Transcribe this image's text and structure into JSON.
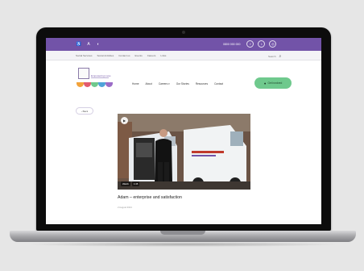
{
  "colors": {
    "topbar": "#7253a8",
    "cta": "#6fc98d",
    "logo_dots": [
      "#f2a23a",
      "#e25b6e",
      "#6fc98d",
      "#4fa3d9",
      "#9b6cc7"
    ]
  },
  "topbar": {
    "left_icons": [
      "accessibility-icon",
      "text-size-icon",
      "contrast-icon"
    ],
    "phone": "0800 000 000",
    "social_icons": [
      "facebook-icon",
      "twitter-icon",
      "instagram-icon"
    ]
  },
  "subnav": {
    "items": [
      "Social Services",
      "Social Activities",
      "Contact us",
      "Events",
      "Careers",
      "Links"
    ],
    "search_label": "Search"
  },
  "logo": {
    "tagline": "Empowering Lives"
  },
  "mainnav": {
    "items": [
      "Home",
      "About",
      "Careers ▾",
      "Our Stories",
      "Resources",
      "Contact"
    ]
  },
  "cta": {
    "label": "Get involved",
    "icon": "user-icon"
  },
  "back_button": "‹ Back",
  "video": {
    "play_icon": "play-icon",
    "tags": [
      "Watch",
      "1:45"
    ]
  },
  "post": {
    "title": "Adam – enterprise and satisfaction",
    "meta": "2 August 2021"
  }
}
